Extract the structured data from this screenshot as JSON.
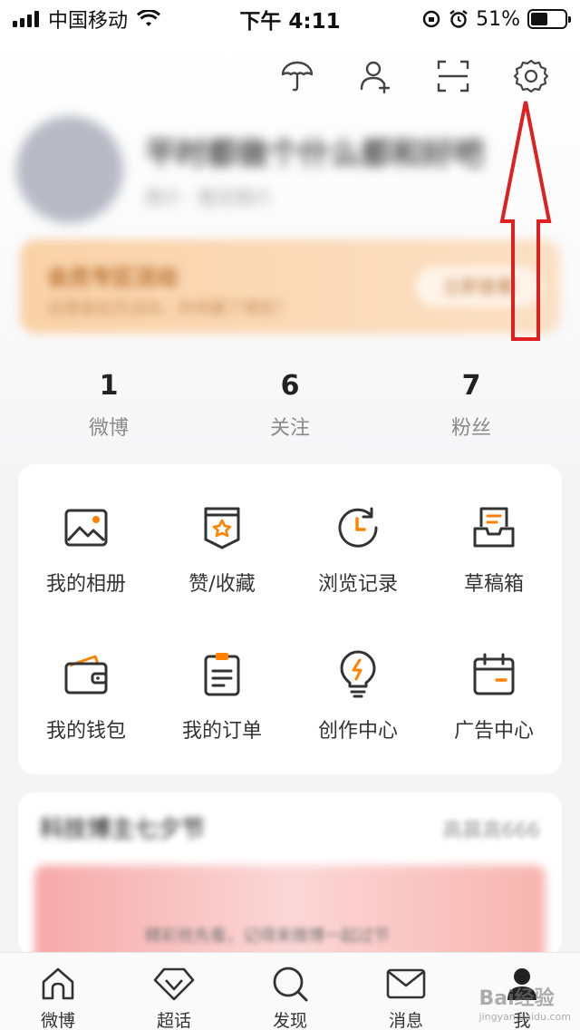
{
  "status_bar": {
    "carrier": "中国移动",
    "time": "下午 4:11",
    "battery": "51%",
    "battery_level": 0.51
  },
  "header_icons": [
    "umbrella-icon",
    "add-friend-icon",
    "scan-icon",
    "settings-icon"
  ],
  "profile": {
    "nickname": "平时都做个什么都和好吧",
    "meta": "简介 · 暂无简介"
  },
  "banner": {
    "title": "会员专区活动",
    "subtitle": "这里是会员活动，你将赢了哪些？",
    "button": "立即查看"
  },
  "stats": [
    {
      "value": "1",
      "label": "微博"
    },
    {
      "value": "6",
      "label": "关注"
    },
    {
      "value": "7",
      "label": "粉丝"
    }
  ],
  "grid": [
    {
      "label": "我的相册",
      "icon": "album-icon"
    },
    {
      "label": "赞/收藏",
      "icon": "favorite-icon"
    },
    {
      "label": "浏览记录",
      "icon": "history-icon"
    },
    {
      "label": "草稿箱",
      "icon": "drafts-icon"
    },
    {
      "label": "我的钱包",
      "icon": "wallet-icon"
    },
    {
      "label": "我的订单",
      "icon": "orders-icon"
    },
    {
      "label": "创作中心",
      "icon": "creator-icon"
    },
    {
      "label": "广告中心",
      "icon": "ads-icon"
    }
  ],
  "feed": {
    "title": "科技博主七夕节",
    "right": "高晨高666",
    "caption": "精彩抢先看，记得来微博一起过节"
  },
  "tabs": [
    {
      "label": "微博",
      "icon": "home-icon"
    },
    {
      "label": "超话",
      "icon": "diamond-icon"
    },
    {
      "label": "发现",
      "icon": "search-icon"
    },
    {
      "label": "消息",
      "icon": "mail-icon"
    },
    {
      "label": "我",
      "icon": "profile-icon"
    }
  ],
  "watermark": {
    "brand": "Bai经验",
    "url": "jingyan.baidu.com"
  },
  "colors": {
    "accent": "#ff8200",
    "arrow": "#e02020"
  }
}
